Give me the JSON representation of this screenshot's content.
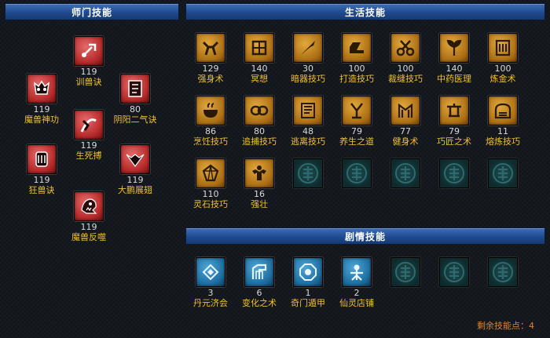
{
  "headers": {
    "school": "师门技能",
    "life": "生活技能",
    "story": "剧情技能"
  },
  "school_skills": [
    {
      "name": "训兽诀",
      "level": "119"
    },
    {
      "name": "魔兽神功",
      "level": "119"
    },
    {
      "name": "阴阳二气诀",
      "level": "80"
    },
    {
      "name": "生死搏",
      "level": "119"
    },
    {
      "name": "狂兽诀",
      "level": "119"
    },
    {
      "name": "大鹏展翅",
      "level": "119"
    },
    {
      "name": "魔兽反噬",
      "level": "119"
    }
  ],
  "life_skills": [
    {
      "name": "强身术",
      "level": "129"
    },
    {
      "name": "冥想",
      "level": "140"
    },
    {
      "name": "暗器技巧",
      "level": "30"
    },
    {
      "name": "打造技巧",
      "level": "100"
    },
    {
      "name": "裁缝技巧",
      "level": "100"
    },
    {
      "name": "中药医理",
      "level": "140"
    },
    {
      "name": "炼金术",
      "level": "100"
    },
    {
      "name": "烹饪技巧",
      "level": "86"
    },
    {
      "name": "追捕技巧",
      "level": "80"
    },
    {
      "name": "逃离技巧",
      "level": "48"
    },
    {
      "name": "养生之道",
      "level": "79"
    },
    {
      "name": "健身术",
      "level": "77"
    },
    {
      "name": "巧匠之术",
      "level": "79"
    },
    {
      "name": "熔炼技巧",
      "level": "11"
    },
    {
      "name": "灵石技巧",
      "level": "110"
    },
    {
      "name": "强壮",
      "level": "16"
    }
  ],
  "story_skills": [
    {
      "name": "丹元济会",
      "level": "3"
    },
    {
      "name": "变化之术",
      "level": "6"
    },
    {
      "name": "奇门遁甲",
      "level": "1"
    },
    {
      "name": "仙灵店铺",
      "level": "2"
    }
  ],
  "remaining_points": "剩余技能点：4",
  "colors": {
    "header_blue": "#1f4a8f",
    "skill_name": "#f0c030",
    "remaining_text": "#e0842a"
  }
}
